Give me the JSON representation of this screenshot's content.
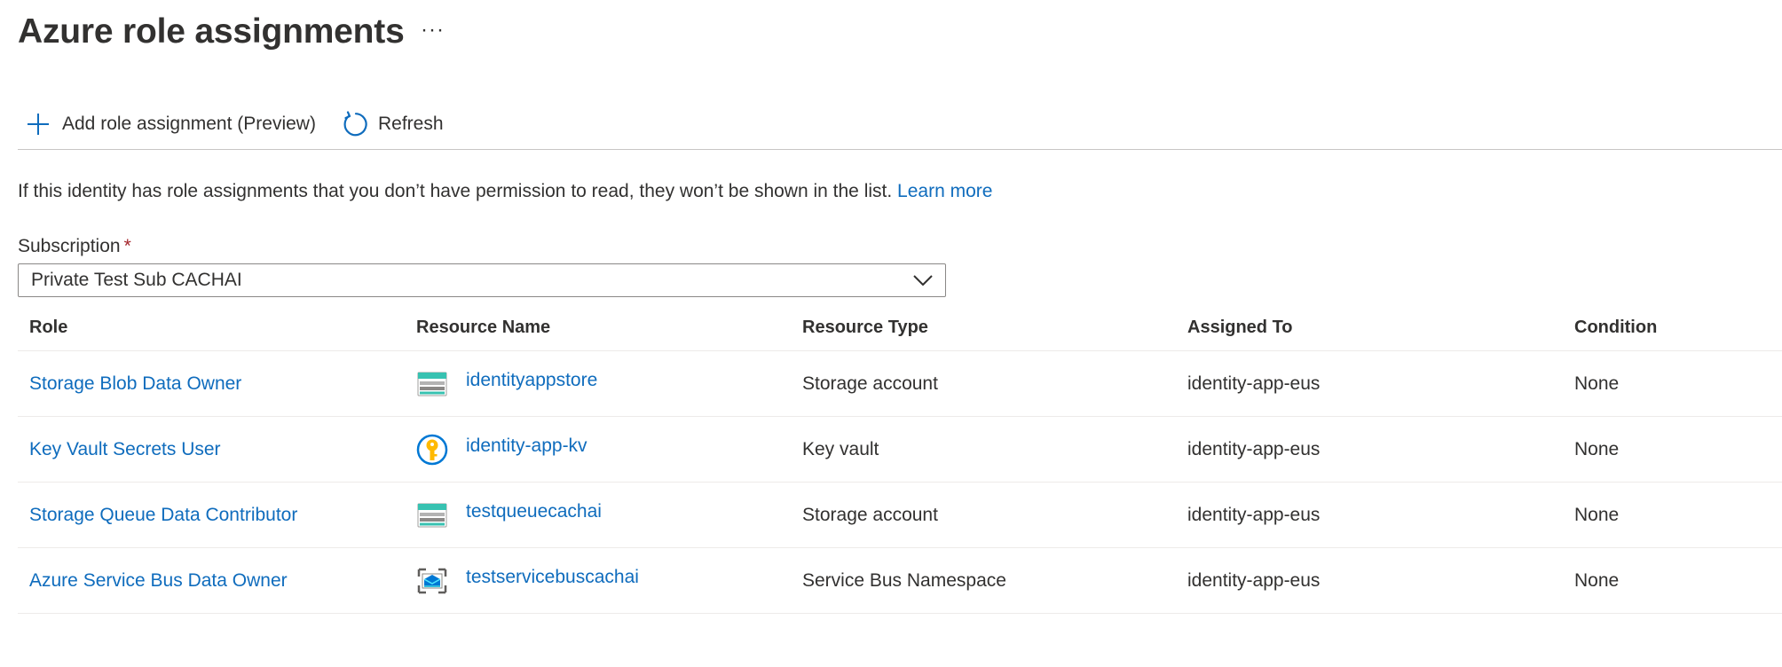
{
  "header": {
    "title": "Azure role assignments",
    "more_label": "···"
  },
  "toolbar": {
    "add_label": "Add role assignment (Preview)",
    "add_icon": "plus-icon",
    "refresh_label": "Refresh",
    "refresh_icon": "refresh-icon"
  },
  "info": {
    "text": "If this identity has role assignments that you don’t have permission to read, they won’t be shown in the list.",
    "learn_more": "Learn more"
  },
  "subscription": {
    "label": "Subscription",
    "required_mark": "*",
    "value": "Private Test Sub CACHAI",
    "icon": "chevron-down-icon"
  },
  "table": {
    "columns": [
      "Role",
      "Resource Name",
      "Resource Type",
      "Assigned To",
      "Condition"
    ],
    "rows": [
      {
        "role": "Storage Blob Data Owner",
        "resource_icon": "storage-account-icon",
        "resource_name": "identityappstore",
        "resource_type": "Storage account",
        "assigned_to": "identity-app-eus",
        "condition": "None"
      },
      {
        "role": "Key Vault Secrets User",
        "resource_icon": "key-vault-icon",
        "resource_name": "identity-app-kv",
        "resource_type": "Key vault",
        "assigned_to": "identity-app-eus",
        "condition": "None"
      },
      {
        "role": "Storage Queue Data Contributor",
        "resource_icon": "storage-account-icon",
        "resource_name": "testqueuecachai",
        "resource_type": "Storage account",
        "assigned_to": "identity-app-eus",
        "condition": "None"
      },
      {
        "role": "Azure Service Bus Data Owner",
        "resource_icon": "service-bus-icon",
        "resource_name": "testservicebuscachai",
        "resource_type": "Service Bus Namespace",
        "assigned_to": "identity-app-eus",
        "condition": "None"
      }
    ]
  },
  "colors": {
    "link": "#0f6cbd",
    "text": "#323130",
    "required": "#a4262c",
    "storage_teal": "#37c2b1",
    "keyvault_yellow": "#ffb900"
  }
}
